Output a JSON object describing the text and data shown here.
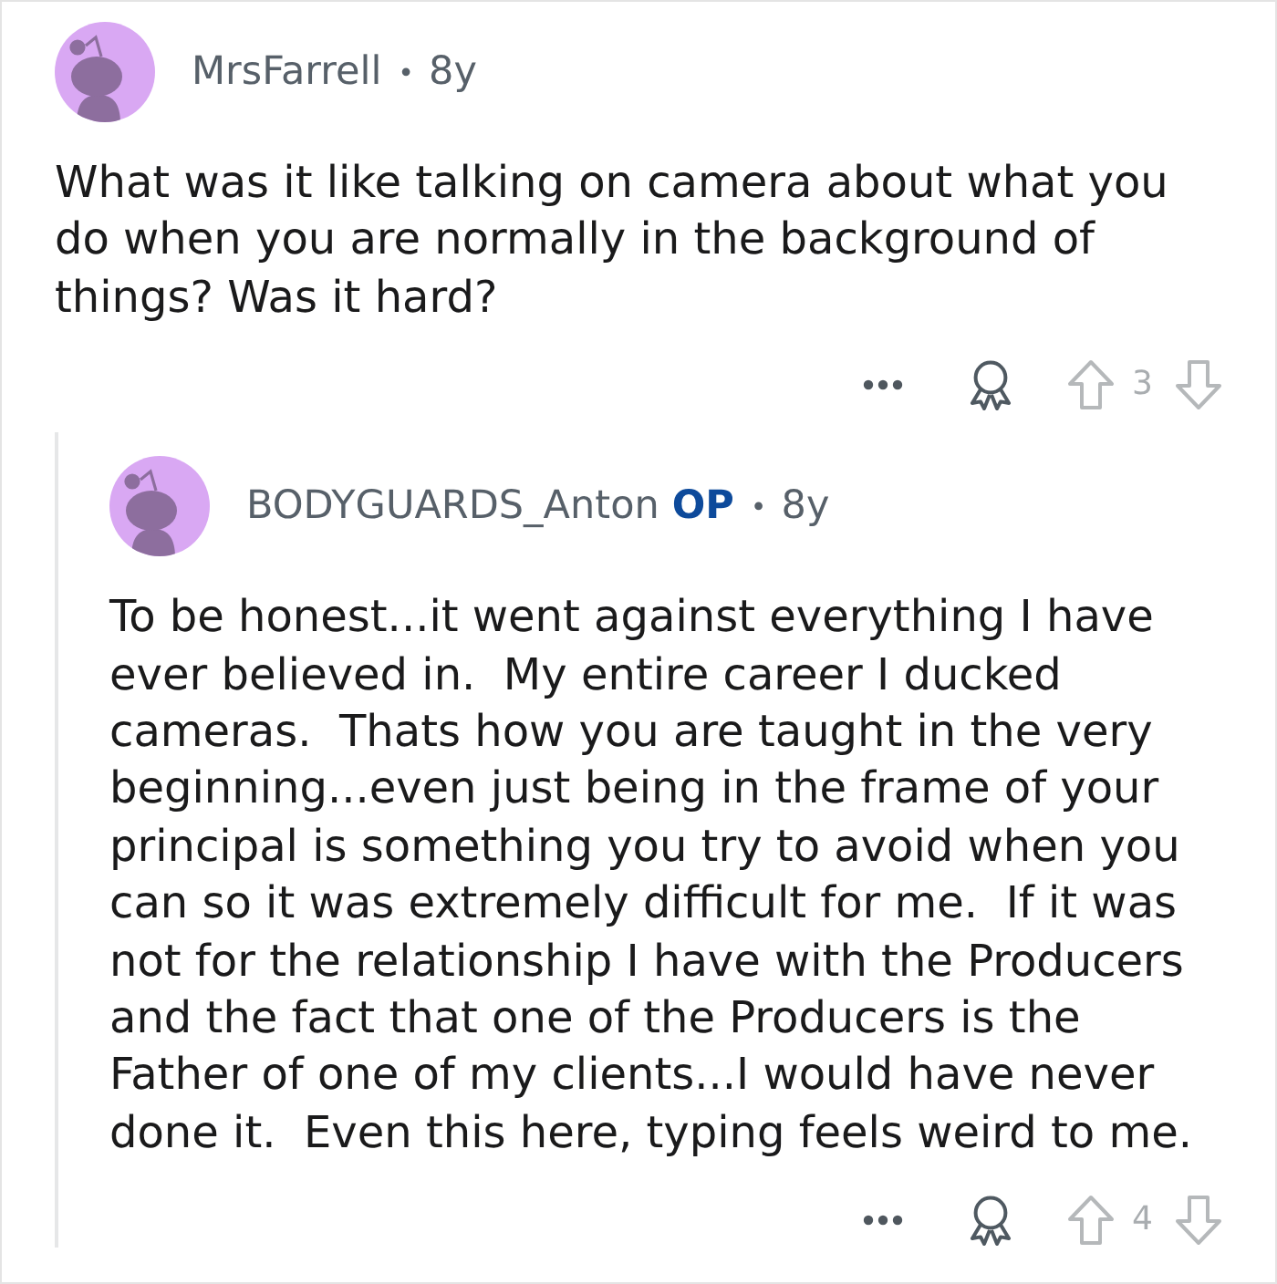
{
  "comments": [
    {
      "author": "MrsFarrell",
      "separator": "•",
      "age": "8y",
      "body": "What was it like talking on camera about what you do when you are normally in the background of things? Was it hard?",
      "votes": "3",
      "children": [
        {
          "author": "BODYGUARDS_Anton",
          "badge": "OP",
          "separator": "•",
          "age": "8y",
          "body": "To be honest...it went against everything I have ever believed in.  My entire career I ducked cameras.  Thats how you are taught in the very beginning...even just being in the frame of your principal is something you try to avoid when you can so it was extremely difficult for me.  If it was not for the relationship I have with the Producers and the fact that one of the Producers is the Father of one of my clients...I would have never done it.  Even this here, typing feels weird to me.",
          "votes": "4"
        }
      ]
    }
  ]
}
